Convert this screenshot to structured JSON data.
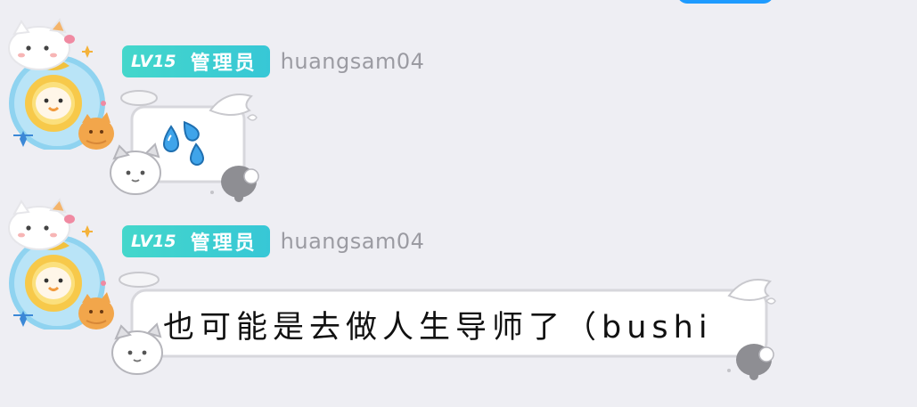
{
  "messages": [
    {
      "level": "LV15",
      "role": "管理员",
      "username": "huangsam04",
      "content_type": "emoji",
      "content_icon": "sweat-drops-icon"
    },
    {
      "level": "LV15",
      "role": "管理员",
      "username": "huangsam04",
      "content_type": "text",
      "text": "也可能是去做人生导师了（bushi"
    }
  ],
  "colors": {
    "background": "#eeeef3",
    "level_badge": "#3fd0cf",
    "username": "#9b9ba2",
    "text": "#111111",
    "top_button": "#1e9bff"
  }
}
